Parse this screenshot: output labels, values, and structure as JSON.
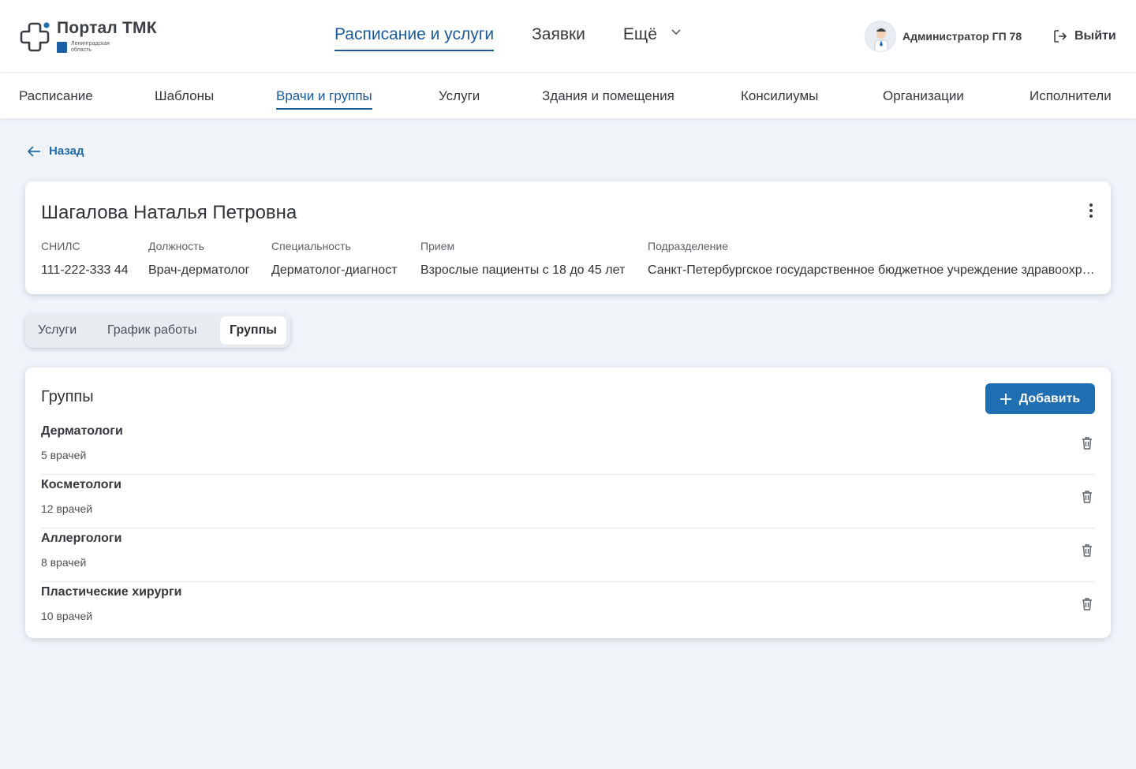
{
  "header": {
    "logo_title": "Портал ТМК",
    "logo_region": "Ленинградская область",
    "nav": [
      {
        "label": "Расписание и услуги",
        "active": true
      },
      {
        "label": "Заявки",
        "active": false
      },
      {
        "label": "Ещё",
        "active": false
      }
    ],
    "user_name": "Администратор ГП 78",
    "logout_label": "Выйти"
  },
  "subnav": [
    {
      "label": "Расписание"
    },
    {
      "label": "Шаблоны"
    },
    {
      "label": "Врачи и группы",
      "active": true
    },
    {
      "label": "Услуги"
    },
    {
      "label": "Здания и помещения"
    },
    {
      "label": "Консилиумы"
    },
    {
      "label": "Организации"
    },
    {
      "label": "Исполнители"
    }
  ],
  "back_label": "Назад",
  "doctor": {
    "name": "Шагалова Наталья Петровна",
    "fields": [
      {
        "label": "СНИЛС",
        "value": "111-222-333 44"
      },
      {
        "label": "Должность",
        "value": "Врач-дерматолог"
      },
      {
        "label": "Специальность",
        "value": "Дерматолог-диагност"
      },
      {
        "label": "Прием",
        "value": "Взрослые пациенты с 18 до 45 лет"
      },
      {
        "label": "Подразделение",
        "value": "Санкт-Петербургское государственное бюджетное учреждение здравоохранения"
      }
    ]
  },
  "tabs": [
    {
      "label": "Услуги"
    },
    {
      "label": "График работы"
    },
    {
      "label": "Группы",
      "active": true
    }
  ],
  "groups": {
    "title": "Группы",
    "add_label": "Добавить",
    "items": [
      {
        "name": "Дерматологи",
        "count": "5 врачей"
      },
      {
        "name": "Косметологи",
        "count": "12 врачей"
      },
      {
        "name": "Аллергологи",
        "count": "8 врачей"
      },
      {
        "name": "Пластические хирурги",
        "count": "10 врачей"
      }
    ]
  },
  "colors": {
    "accent": "#1a5a9a",
    "button": "#1f6fb2",
    "background": "#f0f4f9"
  }
}
